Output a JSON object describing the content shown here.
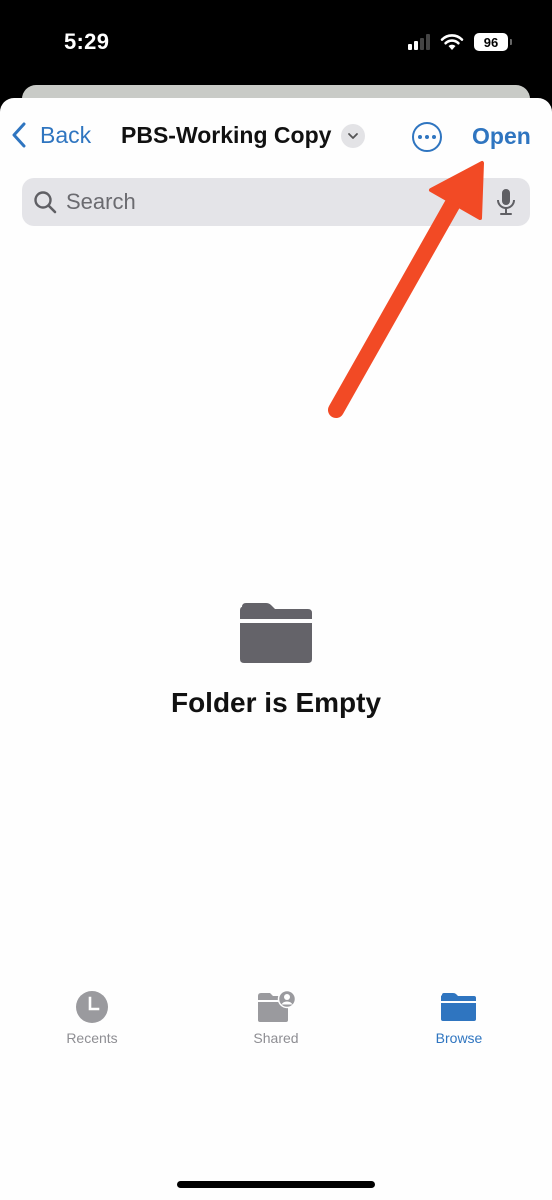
{
  "status_bar": {
    "time": "5:29",
    "signal_bars_active": 2,
    "signal_bars_total": 4,
    "wifi": "wifi-icon",
    "battery_percent": "96"
  },
  "nav": {
    "back_label": "Back",
    "title": "PBS-Working Copy",
    "title_menu_icon": "chevron-down-icon",
    "more_icon": "ellipsis-circle-icon",
    "open_label": "Open"
  },
  "search": {
    "placeholder": "Search",
    "value": "",
    "search_icon": "magnifying-glass-icon",
    "mic_icon": "microphone-icon"
  },
  "empty_state": {
    "icon": "folder-icon",
    "message": "Folder is Empty"
  },
  "tabs": [
    {
      "label": "Recents",
      "icon": "clock-icon",
      "active": false
    },
    {
      "label": "Shared",
      "icon": "shared-folder-icon",
      "active": false
    },
    {
      "label": "Browse",
      "icon": "folder-icon",
      "active": true
    }
  ],
  "annotation": {
    "type": "arrow",
    "color": "#f24a25",
    "points_to": "Open"
  },
  "colors": {
    "accent": "#2f75c0",
    "inactive": "#8e8e93",
    "folder_gray": "#646369"
  }
}
